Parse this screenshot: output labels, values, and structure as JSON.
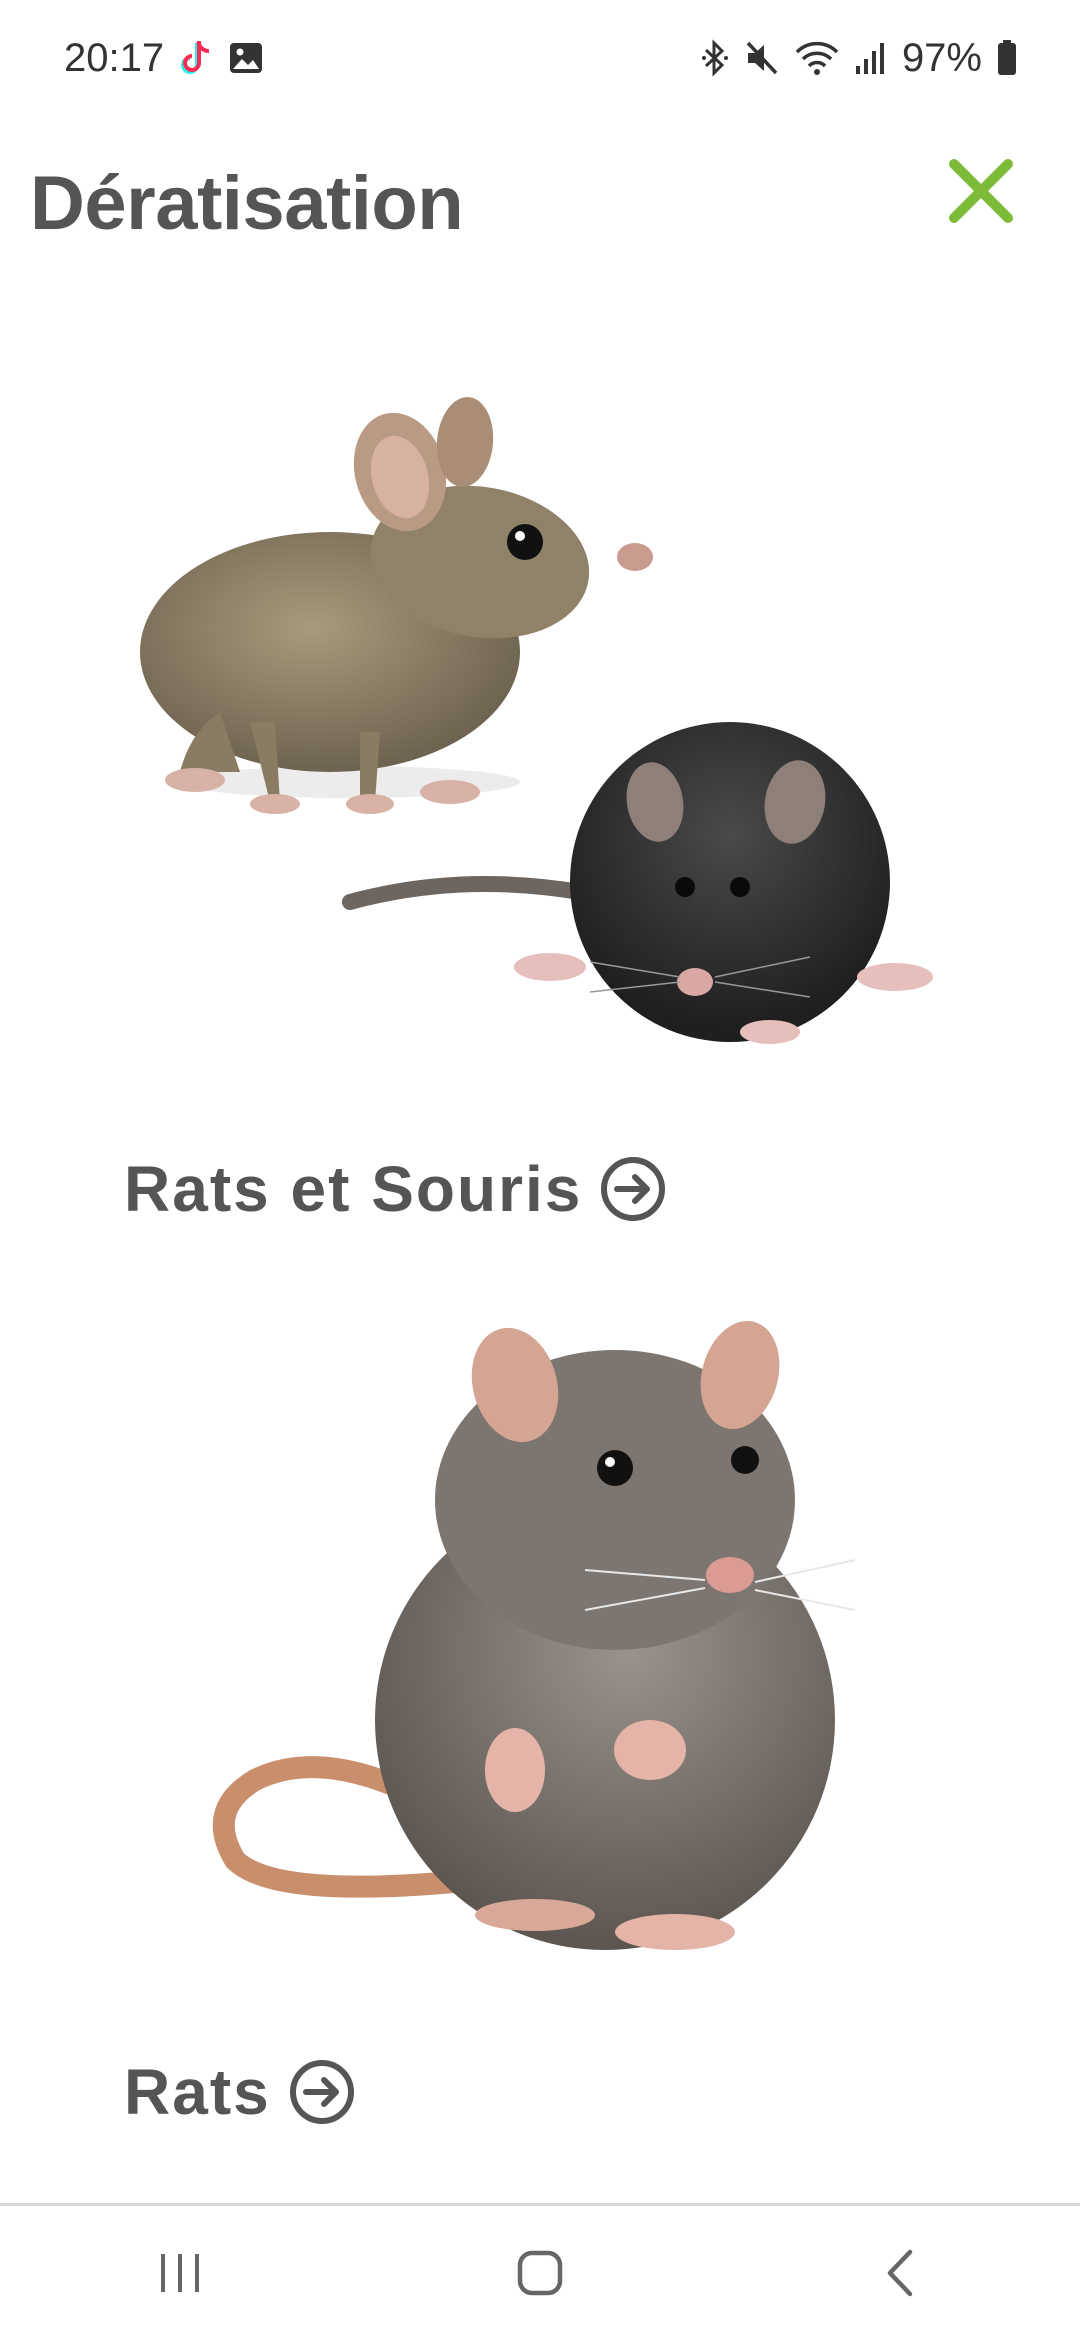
{
  "status_bar": {
    "time": "20:17",
    "battery": "97%",
    "left_icons": [
      "tiktok-icon",
      "gallery-icon"
    ],
    "right_icons": [
      "bluetooth-icon",
      "mute-icon",
      "wifi-icon",
      "signal-icon",
      "battery-icon"
    ]
  },
  "header": {
    "title": "Dératisation",
    "close_icon": "close-icon",
    "accent_color": "#7dba38"
  },
  "cards": [
    {
      "label": "Rats et Souris",
      "image": "mouse-and-rat-photo",
      "arrow_icon": "arrow-right-circle-icon"
    },
    {
      "label": "Rats",
      "image": "rat-photo",
      "arrow_icon": "arrow-right-circle-icon"
    }
  ],
  "nav_bar": {
    "items": [
      "recent-apps-icon",
      "home-icon",
      "back-icon"
    ]
  }
}
